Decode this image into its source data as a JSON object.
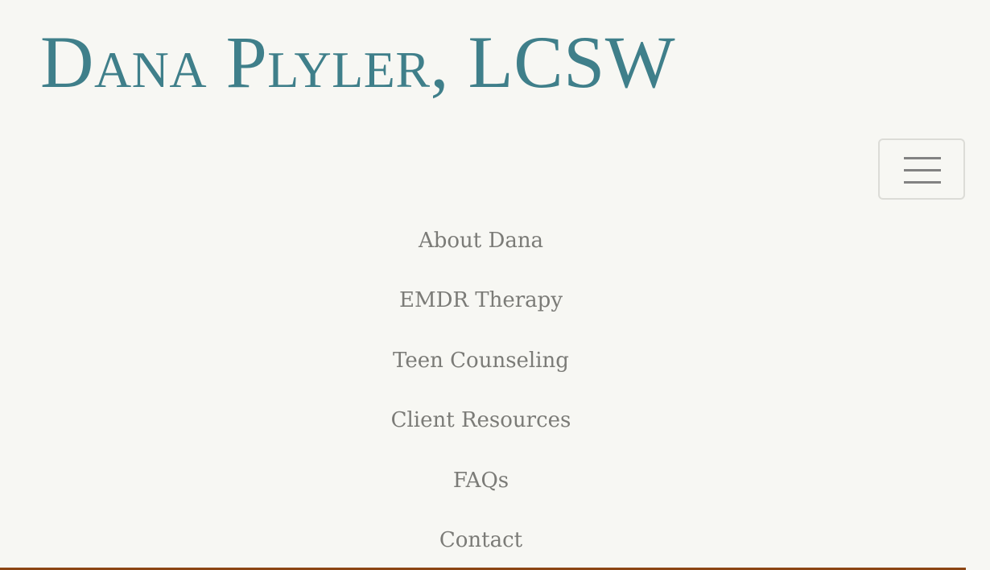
{
  "site": {
    "title": "Dana Plyler, LCSW"
  },
  "header": {
    "menu_icon": "hamburger-icon"
  },
  "nav": {
    "items": [
      {
        "label": "About Dana"
      },
      {
        "label": "EMDR Therapy"
      },
      {
        "label": "Teen Counseling"
      },
      {
        "label": "Client Resources"
      },
      {
        "label": "FAQs"
      },
      {
        "label": "Contact"
      }
    ]
  },
  "colors": {
    "background": "#f7f7f3",
    "logo": "#3f7f8a",
    "nav_text": "#7b7b77",
    "rule": "#8b4513"
  }
}
